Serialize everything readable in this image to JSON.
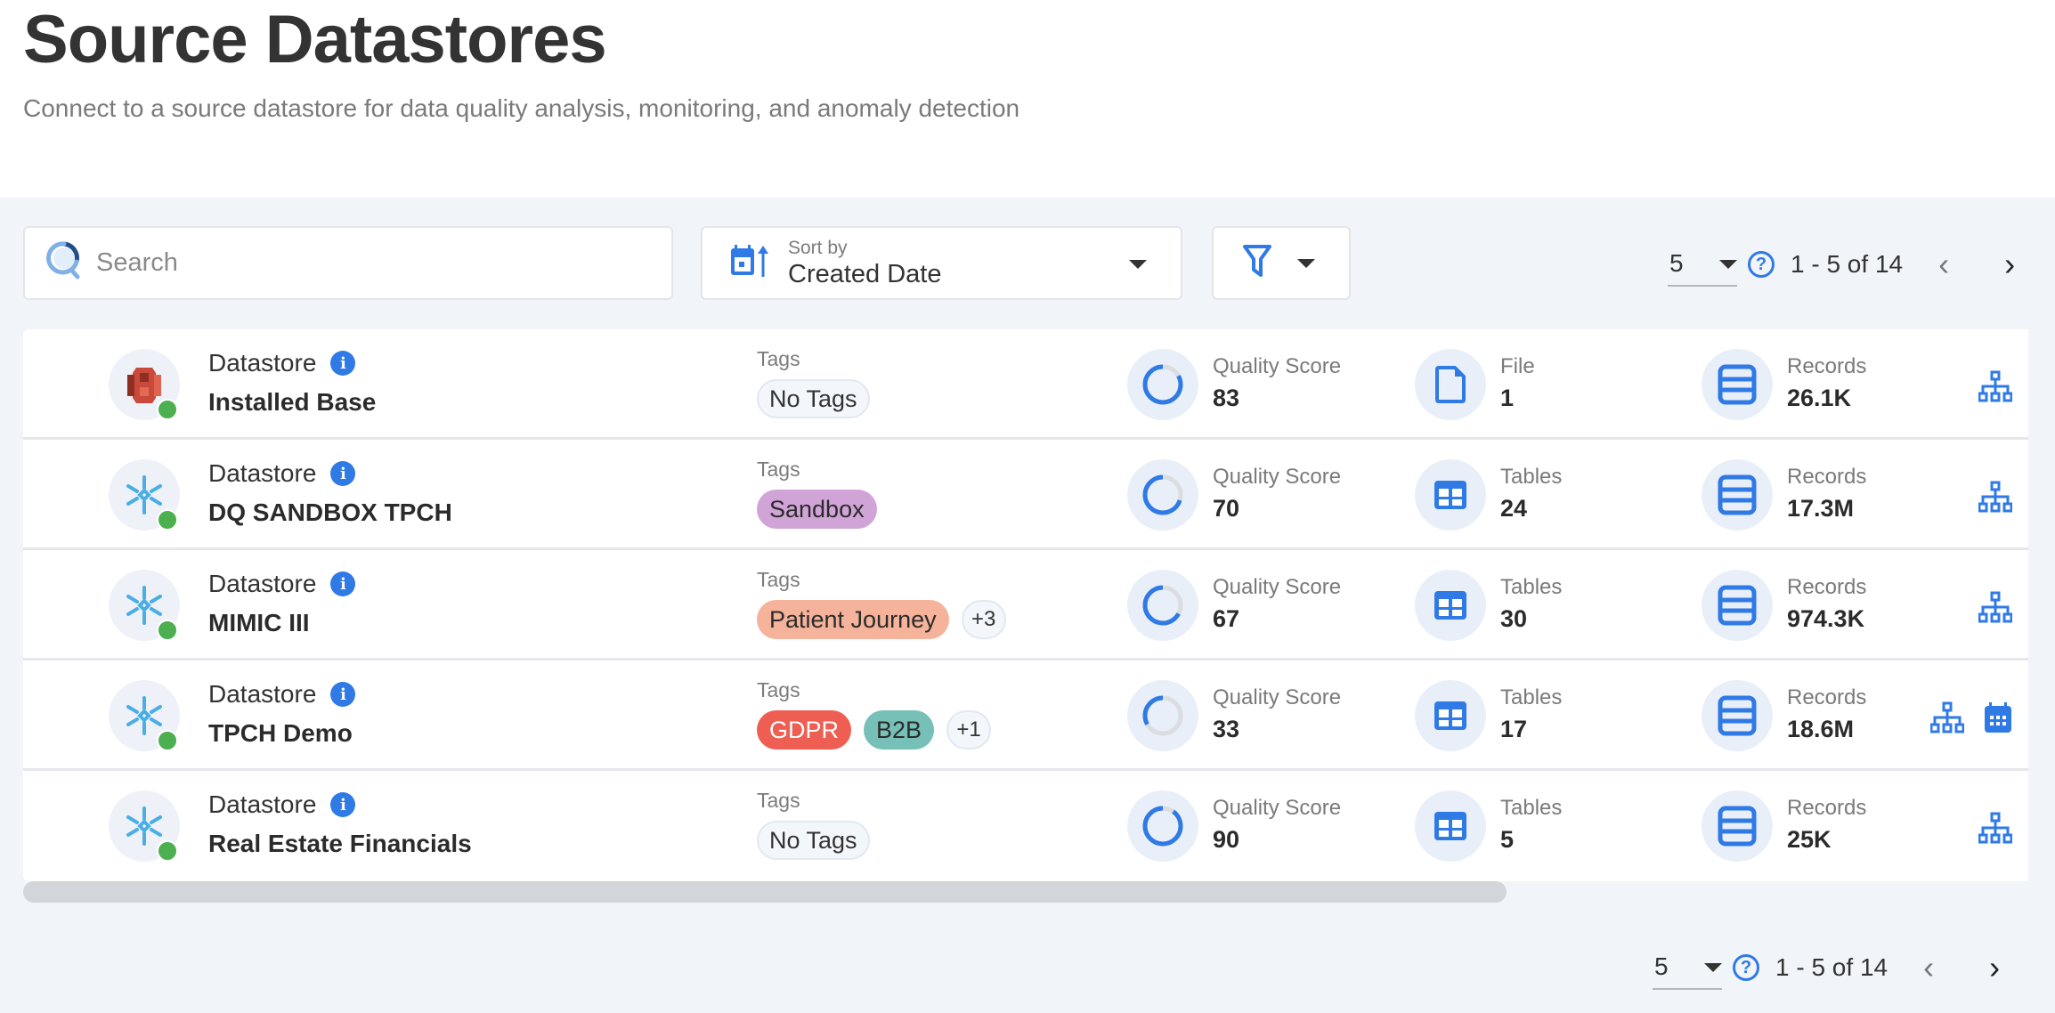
{
  "header": {
    "title": "Source Datastores",
    "subtitle": "Connect to a source datastore for data quality analysis, monitoring, and anomaly detection"
  },
  "toolbar": {
    "search_placeholder": "Search",
    "search_value": "",
    "sort_label": "Sort by",
    "sort_value": "Created Date",
    "filter_icon": "filter-icon"
  },
  "pagination_top": {
    "page_size": "5",
    "range": "1 - 5 of 14",
    "prev": "‹",
    "next": "›"
  },
  "pagination_bottom": {
    "page_size": "5",
    "range": "1 - 5 of 14",
    "prev": "‹",
    "next": "›"
  },
  "colors": {
    "accent": "#2f7ae5",
    "status_ok": "#4caf50",
    "tag_sandbox": "#d1a4d8",
    "tag_patient_journey": "#f4b39a",
    "tag_gdpr": "#ee5e52",
    "tag_b2b": "#76c0b8"
  },
  "rows": [
    {
      "type_label": "Datastore",
      "name": "Installed Base",
      "icon": "amazon-s3-icon",
      "status": "connected",
      "tags_label": "Tags",
      "tags": [
        {
          "label": "No Tags",
          "kind": "none"
        }
      ],
      "quality_label": "Quality Score",
      "quality": "83",
      "quality_fraction": 0.83,
      "count_label": "File",
      "count": "1",
      "count_icon": "file-icon",
      "records_label": "Records",
      "records": "26.1K",
      "actions": [
        "tree-icon"
      ]
    },
    {
      "type_label": "Datastore",
      "name": "DQ SANDBOX TPCH",
      "icon": "snowflake-icon",
      "status": "connected",
      "tags_label": "Tags",
      "tags": [
        {
          "label": "Sandbox",
          "kind": "color",
          "color": "#d1a4d8",
          "text": "#2b2b2b"
        }
      ],
      "quality_label": "Quality Score",
      "quality": "70",
      "quality_fraction": 0.7,
      "count_label": "Tables",
      "count": "24",
      "count_icon": "table-icon",
      "records_label": "Records",
      "records": "17.3M",
      "actions": [
        "tree-icon"
      ]
    },
    {
      "type_label": "Datastore",
      "name": "MIMIC III",
      "icon": "snowflake-icon",
      "status": "connected",
      "tags_label": "Tags",
      "tags": [
        {
          "label": "Patient Journey",
          "kind": "color",
          "color": "#f4b39a",
          "text": "#2b2b2b"
        },
        {
          "label": "+3",
          "kind": "more"
        }
      ],
      "quality_label": "Quality Score",
      "quality": "67",
      "quality_fraction": 0.67,
      "count_label": "Tables",
      "count": "30",
      "count_icon": "table-icon",
      "records_label": "Records",
      "records": "974.3K",
      "actions": [
        "tree-icon"
      ]
    },
    {
      "type_label": "Datastore",
      "name": "TPCH Demo",
      "icon": "snowflake-icon",
      "status": "connected",
      "tags_label": "Tags",
      "tags": [
        {
          "label": "GDPR",
          "kind": "color",
          "color": "#ee5e52",
          "text": "#ffffff"
        },
        {
          "label": "B2B",
          "kind": "color",
          "color": "#76c0b8",
          "text": "#2b2b2b"
        },
        {
          "label": "+1",
          "kind": "more"
        }
      ],
      "quality_label": "Quality Score",
      "quality": "33",
      "quality_fraction": 0.33,
      "count_label": "Tables",
      "count": "17",
      "count_icon": "table-icon",
      "records_label": "Records",
      "records": "18.6M",
      "actions": [
        "tree-icon",
        "calendar-icon"
      ]
    },
    {
      "type_label": "Datastore",
      "name": "Real Estate Financials",
      "icon": "snowflake-icon",
      "status": "connected",
      "tags_label": "Tags",
      "tags": [
        {
          "label": "No Tags",
          "kind": "none"
        }
      ],
      "quality_label": "Quality Score",
      "quality": "90",
      "quality_fraction": 0.9,
      "count_label": "Tables",
      "count": "5",
      "count_icon": "table-icon",
      "records_label": "Records",
      "records": "25K",
      "actions": [
        "tree-icon"
      ]
    }
  ]
}
